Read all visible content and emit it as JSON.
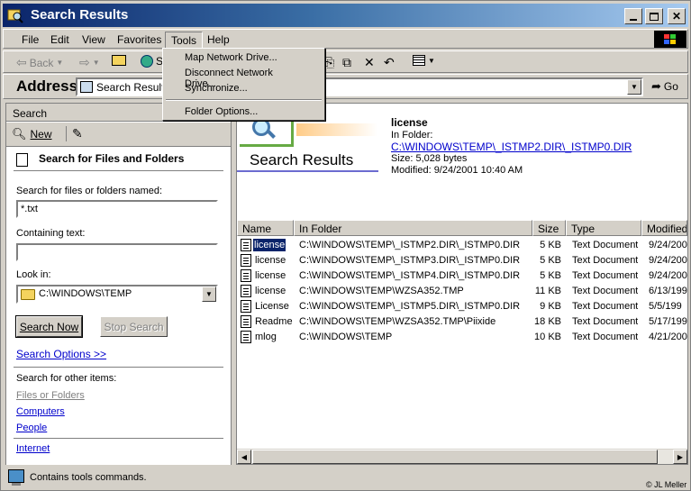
{
  "window": {
    "title": "Search Results"
  },
  "menu": {
    "items": [
      "File",
      "Edit",
      "View",
      "Favorites",
      "Tools",
      "Help"
    ]
  },
  "tools_menu": {
    "items": [
      "Map Network Drive...",
      "Disconnect Network Drive...",
      "Synchronize...",
      "Folder Options..."
    ]
  },
  "toolbar": {
    "back_label": "Back"
  },
  "address": {
    "label": "Address",
    "value": "Search Results",
    "go_label": "Go"
  },
  "search_pane": {
    "header": "Search",
    "new_label": "New",
    "title": "Search for Files and Folders",
    "named_label": "Search for files or folders named:",
    "named_value": "*.txt",
    "containing_label": "Containing text:",
    "containing_value": "",
    "look_in_label": "Look in:",
    "look_in_value": "C:\\WINDOWS\\TEMP",
    "search_now": "Search Now",
    "stop_search": "Stop Search",
    "options_link": "Search Options >>",
    "other_label": "Search for other items:",
    "other_items": [
      "Files or Folders",
      "Computers",
      "People",
      "Internet"
    ]
  },
  "preview": {
    "heading": "Search Results",
    "file_name": "license",
    "in_folder_label": "In Folder:",
    "folder_path": "C:\\WINDOWS\\TEMP\\_ISTMP2.DIR\\_ISTMP0.DIR",
    "size": "Size: 5,028 bytes",
    "modified": "Modified: 9/24/2001 10:40 AM"
  },
  "results": {
    "columns": [
      "Name",
      "In Folder",
      "Size",
      "Type",
      "Modified"
    ],
    "rows": [
      {
        "name": "license",
        "folder": "C:\\WINDOWS\\TEMP\\_ISTMP2.DIR\\_ISTMP0.DIR",
        "size": "5 KB",
        "type": "Text Document",
        "modified": "9/24/200"
      },
      {
        "name": "license",
        "folder": "C:\\WINDOWS\\TEMP\\_ISTMP3.DIR\\_ISTMP0.DIR",
        "size": "5 KB",
        "type": "Text Document",
        "modified": "9/24/200"
      },
      {
        "name": "license",
        "folder": "C:\\WINDOWS\\TEMP\\_ISTMP4.DIR\\_ISTMP0.DIR",
        "size": "5 KB",
        "type": "Text Document",
        "modified": "9/24/200"
      },
      {
        "name": "license",
        "folder": "C:\\WINDOWS\\TEMP\\WZSA352.TMP",
        "size": "11 KB",
        "type": "Text Document",
        "modified": "6/13/199"
      },
      {
        "name": "License",
        "folder": "C:\\WINDOWS\\TEMP\\_ISTMP5.DIR\\_ISTMP0.DIR",
        "size": "9 KB",
        "type": "Text Document",
        "modified": "5/5/199"
      },
      {
        "name": "Readme",
        "folder": "C:\\WINDOWS\\TEMP\\WZSA352.TMP\\Piixide",
        "size": "18 KB",
        "type": "Text Document",
        "modified": "5/17/199"
      },
      {
        "name": "mlog",
        "folder": "C:\\WINDOWS\\TEMP",
        "size": "10 KB",
        "type": "Text Document",
        "modified": "4/21/200"
      }
    ]
  },
  "status": {
    "text": "Contains tools commands.",
    "credit": "© JL Meller"
  },
  "colors": {
    "title_start": "#0a246a",
    "title_end": "#a6caf0",
    "link": "#0000cc",
    "selection": "#0a246a"
  }
}
